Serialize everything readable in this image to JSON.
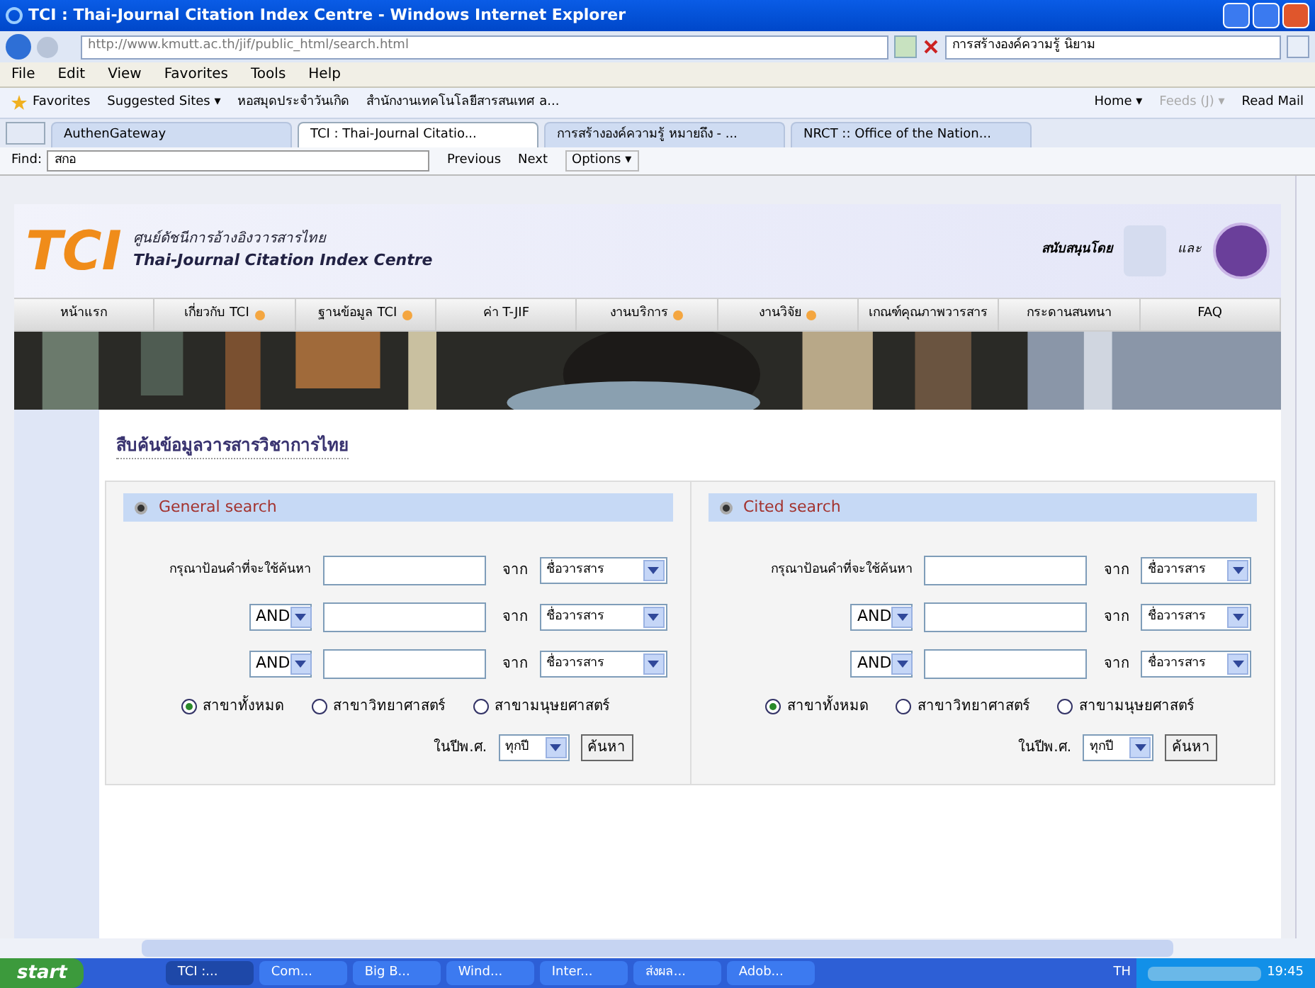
{
  "window": {
    "title": "TCI : Thai-Journal Citation Index Centre - Windows Internet Explorer"
  },
  "address_bar": {
    "url": "http://www.kmutt.ac.th/jif/public_html/search.html",
    "search_value": "การสร้างองค์ความรู้ นิยาม"
  },
  "menu": [
    "File",
    "Edit",
    "View",
    "Favorites",
    "Tools",
    "Help"
  ],
  "favorites_bar": {
    "favorites": "Favorites",
    "items": [
      "Suggested Sites ▾",
      "หอสมุดประจำวันเกิด",
      "สำนักงานเทคโนโลยีสารสนเทศ a..."
    ],
    "right": [
      "Home ▾",
      "Feeds (J) ▾",
      "Read Mail"
    ]
  },
  "tabs": [
    {
      "label": "AuthenGateway",
      "selected": false
    },
    {
      "label": "TCI : Thai-Journal Citatio...",
      "selected": true
    },
    {
      "label": "การสร้างองค์ความรู้ หมายถึง - ...",
      "selected": false
    },
    {
      "label": "NRCT :: Office of the Nation...",
      "selected": false
    }
  ],
  "find_bar": {
    "label": "Find:",
    "value": "สกอ",
    "buttons": [
      "Previous",
      "Next"
    ],
    "options": "Options ▾"
  },
  "site_header": {
    "logo": "TCI",
    "thai_name": "ศูนย์ดัชนีการอ้างอิงวารสารไทย",
    "english_name": "Thai-Journal Citation Index Centre",
    "supported_by": "สนับสนุนโดย",
    "and": "และ"
  },
  "nav": [
    {
      "label": "หน้าแรก",
      "arrow": false
    },
    {
      "label": "เกี่ยวกับ TCI",
      "arrow": true
    },
    {
      "label": "ฐานข้อมูล TCI",
      "arrow": true
    },
    {
      "label": "ค่า T-JIF",
      "arrow": false
    },
    {
      "label": "งานบริการ",
      "arrow": true
    },
    {
      "label": "งานวิจัย",
      "arrow": true
    },
    {
      "label": "เกณฑ์คุณภาพวารสาร",
      "arrow": false
    },
    {
      "label": "กระดานสนทนา",
      "arrow": false
    },
    {
      "label": "FAQ",
      "arrow": false
    }
  ],
  "page_title": "สืบค้นข้อมูลวารสารวิชาการไทย",
  "panels": [
    {
      "title": "General search",
      "rows": [
        {
          "kind": "label",
          "label": "กรุณาป้อนคำที่จะใช้ค้นหา",
          "from": "จาก",
          "field": "ชื่อวารสาร"
        },
        {
          "kind": "operator",
          "operator": "AND",
          "from": "จาก",
          "field": "ชื่อวารสาร"
        },
        {
          "kind": "operator",
          "operator": "AND",
          "from": "จาก",
          "field": "ชื่อวารสาร"
        }
      ],
      "radios": [
        {
          "label": "สาขาทั้งหมด",
          "selected": true
        },
        {
          "label": "สาขาวิทยาศาสตร์",
          "selected": false
        },
        {
          "label": "สาขามนุษยศาสตร์",
          "selected": false
        }
      ],
      "year_label": "ในปีพ.ศ.",
      "year": "ทุกปี",
      "button": "ค้นหา"
    },
    {
      "title": "Cited search",
      "rows": [
        {
          "kind": "label",
          "label": "กรุณาป้อนคำที่จะใช้ค้นหา",
          "from": "จาก",
          "field": "ชื่อวารสาร"
        },
        {
          "kind": "operator",
          "operator": "AND",
          "from": "จาก",
          "field": "ชื่อวารสาร"
        },
        {
          "kind": "operator",
          "operator": "AND",
          "from": "จาก",
          "field": "ชื่อวารสาร"
        }
      ],
      "radios": [
        {
          "label": "สาขาทั้งหมด",
          "selected": true
        },
        {
          "label": "สาขาวิทยาศาสตร์",
          "selected": false
        },
        {
          "label": "สาขามนุษยศาสตร์",
          "selected": false
        }
      ],
      "year_label": "ในปีพ.ศ.",
      "year": "ทุกปี",
      "button": "ค้นหา"
    }
  ],
  "taskbar": {
    "start": "start",
    "items": [
      {
        "label": "TCI :...",
        "selected": true
      },
      {
        "label": "Com...",
        "selected": false
      },
      {
        "label": "Big B...",
        "selected": false
      },
      {
        "label": "Wind...",
        "selected": false
      },
      {
        "label": "Inter...",
        "selected": false
      },
      {
        "label": "ส่งผล...",
        "selected": false
      },
      {
        "label": "Adob...",
        "selected": false
      }
    ],
    "language": "TH",
    "clock": "19:45"
  }
}
